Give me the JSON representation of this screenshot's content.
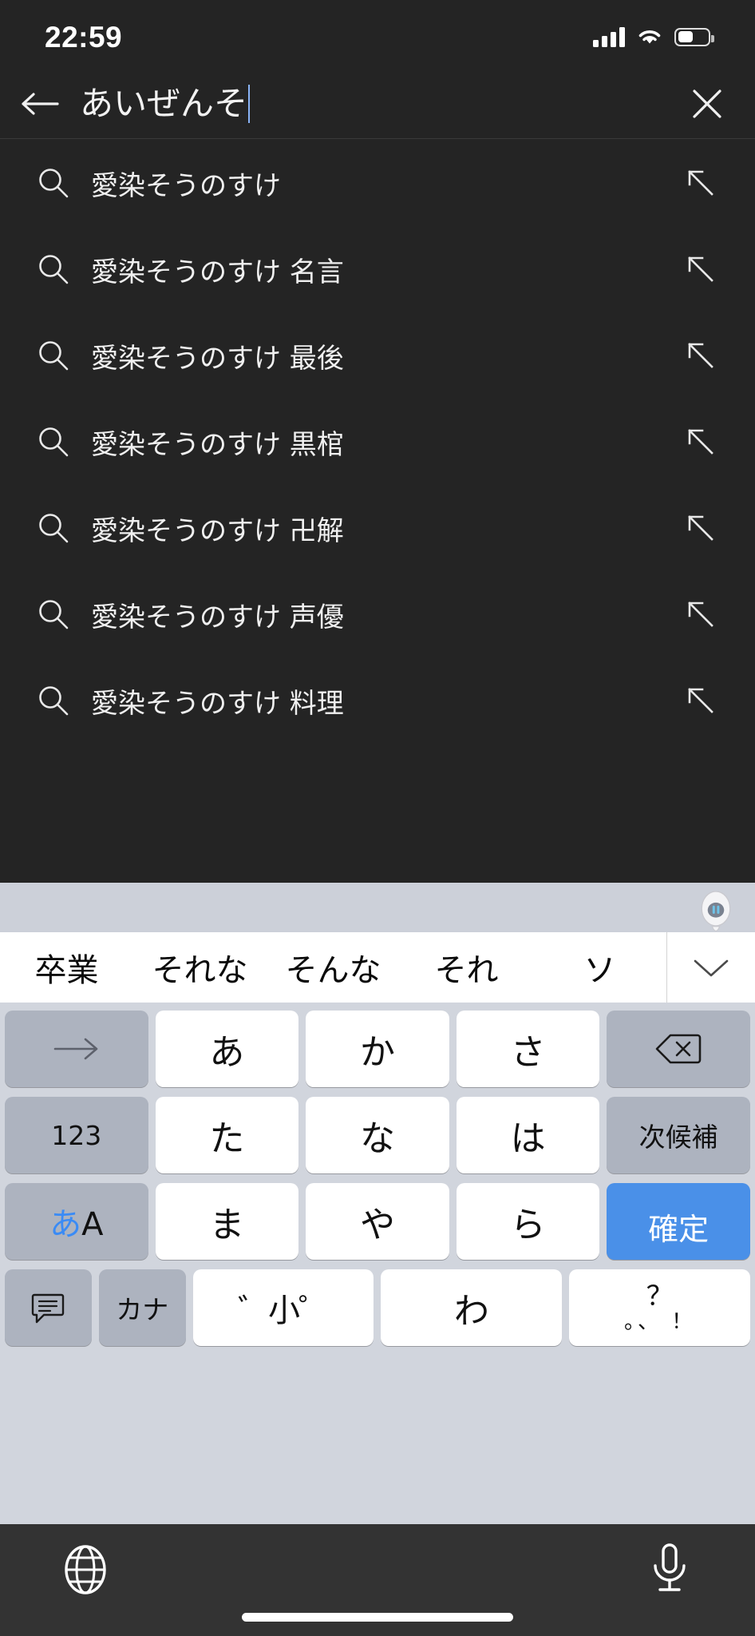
{
  "status_bar": {
    "time": "22:59",
    "signal_icon": "cellular-signal-icon",
    "wifi_icon": "wifi-icon",
    "battery_icon": "battery-icon",
    "battery_level_percent": 45
  },
  "search_bar": {
    "back_icon": "back-arrow-icon",
    "query": "あいぜんそ",
    "placeholder": "",
    "clear_icon": "close-icon"
  },
  "suggestions": {
    "row_icon": "search-icon",
    "fill_icon": "arrow-up-left-icon",
    "items": [
      {
        "label": "愛染そうのすけ"
      },
      {
        "label": "愛染そうのすけ 名言"
      },
      {
        "label": "愛染そうのすけ 最後"
      },
      {
        "label": "愛染そうのすけ 黒棺"
      },
      {
        "label": "愛染そうのすけ 卍解"
      },
      {
        "label": "愛染そうのすけ 声優"
      },
      {
        "label": "愛染そうのすけ 料理"
      }
    ]
  },
  "keyboard": {
    "handle_icon": "ime-robot-icon",
    "candidates": [
      "卒業",
      "それな",
      "そんな",
      "それ",
      "ソ"
    ],
    "expand_icon": "chevron-down-icon",
    "rows": [
      [
        {
          "label": "→",
          "name": "cursor-right-key",
          "style": "grey"
        },
        {
          "label": "あ",
          "name": "a-row-key",
          "style": "white"
        },
        {
          "label": "か",
          "name": "ka-row-key",
          "style": "white"
        },
        {
          "label": "さ",
          "name": "sa-row-key",
          "style": "white"
        },
        {
          "label": "⌫",
          "name": "backspace-key",
          "style": "grey"
        }
      ],
      [
        {
          "label": "123",
          "name": "numeric-key",
          "style": "grey"
        },
        {
          "label": "た",
          "name": "ta-row-key",
          "style": "white"
        },
        {
          "label": "な",
          "name": "na-row-key",
          "style": "white"
        },
        {
          "label": "は",
          "name": "ha-row-key",
          "style": "white"
        },
        {
          "label": "次候補",
          "name": "next-candidate-key",
          "style": "grey"
        }
      ],
      [
        {
          "label": "あA",
          "name": "input-mode-key",
          "style": "grey"
        },
        {
          "label": "ま",
          "name": "ma-row-key",
          "style": "white"
        },
        {
          "label": "や",
          "name": "ya-row-key",
          "style": "white"
        },
        {
          "label": "ら",
          "name": "ra-row-key",
          "style": "white"
        },
        {
          "label": "確定",
          "name": "confirm-key",
          "style": "blue"
        }
      ],
      [
        {
          "label": "",
          "name": "emoji-key",
          "style": "grey"
        },
        {
          "label": "カナ",
          "name": "kana-key",
          "style": "grey"
        },
        {
          "label": "゛小゜",
          "name": "dakuten-small-key",
          "style": "white"
        },
        {
          "label": "わ",
          "name": "wa-row-key",
          "style": "white"
        },
        {
          "label": "。、？！",
          "name": "punctuation-key",
          "style": "white"
        }
      ]
    ],
    "punctuation_top": "？",
    "punctuation_bottom": "。、 ！"
  },
  "bottom_bar": {
    "globe_icon": "globe-icon",
    "mic_icon": "microphone-icon",
    "home_indicator": "home-indicator"
  },
  "colors": {
    "background": "#242424",
    "keyboard_bg": "#d1d5dd",
    "key_white": "#ffffff",
    "key_grey": "#adb3bf",
    "accent_blue": "#4a90e8",
    "caret_blue": "#8ab4f8"
  }
}
